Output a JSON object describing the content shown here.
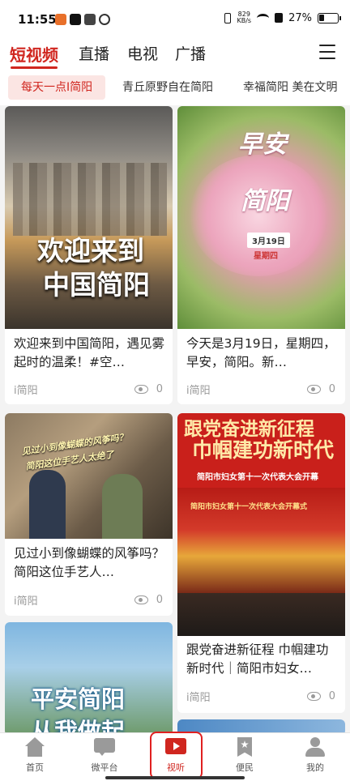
{
  "status_bar": {
    "time": "11:55",
    "net_speed_value": "829",
    "net_speed_unit": "KB/s",
    "battery": "27%"
  },
  "top_tabs": [
    {
      "label": "短视频",
      "active": true
    },
    {
      "label": "直播",
      "active": false
    },
    {
      "label": "电视",
      "active": false
    },
    {
      "label": "广播",
      "active": false
    }
  ],
  "sub_tabs": [
    {
      "label": "每天一点I简阳",
      "active": true
    },
    {
      "label": "青丘原野自在简阳",
      "active": false
    },
    {
      "label": "幸福简阳 美在文明",
      "active": false
    }
  ],
  "cards": [
    {
      "title": "欢迎来到中国简阳，遇见雾起时的温柔！#空…",
      "source": "i简阳",
      "views": "0",
      "overlay": [
        "欢迎来到",
        "中国简阳"
      ]
    },
    {
      "title": "今天是3月19日，星期四，早安，简阳。新…",
      "source": "i简阳",
      "views": "0",
      "overlay": [
        "早安",
        "简阳",
        "3月19日",
        "星期四"
      ]
    },
    {
      "title": "见过小到像蝴蝶的风筝吗？简阳这位手艺人…",
      "source": "i简阳",
      "views": "0",
      "overlay": [
        "见过小到像蝴蝶的风筝吗？",
        "简阳这位手艺人太绝了"
      ]
    },
    {
      "title": "跟党奋进新征程 巾帼建功新时代｜简阳市妇女…",
      "source": "i简阳",
      "views": "0",
      "overlay": [
        "跟党奋进新征程",
        "巾帼建功新时代",
        "简阳市妇女第十一次代表大会开幕",
        "简阳市妇女第十一次代表大会开幕式"
      ]
    },
    {
      "title": "",
      "source": "",
      "views": "",
      "overlay": [
        "平安简阳",
        "从我做起"
      ]
    }
  ],
  "bottom_nav": [
    {
      "label": "首页",
      "icon": "home-icon"
    },
    {
      "label": "微平台",
      "icon": "chat-icon"
    },
    {
      "label": "视听",
      "icon": "play-icon",
      "active": true
    },
    {
      "label": "便民",
      "icon": "bookmark-star-icon"
    },
    {
      "label": "我的",
      "icon": "person-icon"
    }
  ],
  "colors": {
    "accent": "#d0261f",
    "highlight_box": "#e02020"
  }
}
